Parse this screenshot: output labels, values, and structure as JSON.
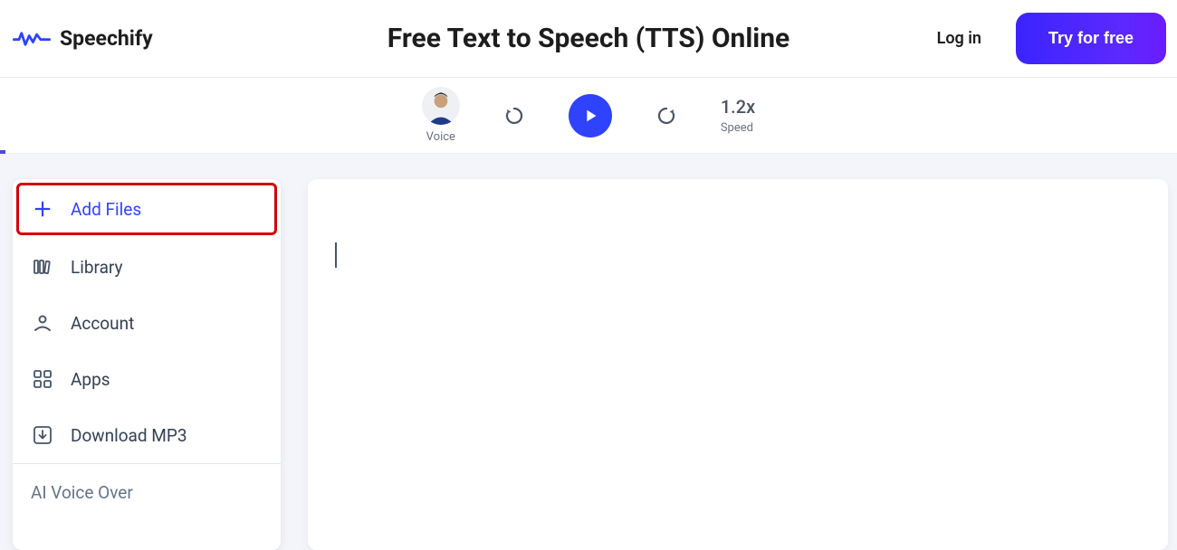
{
  "brand": {
    "name": "Speechify"
  },
  "header": {
    "title": "Free Text to Speech (TTS) Online",
    "login": "Log in",
    "cta": "Try for free"
  },
  "player": {
    "voice_label": "Voice",
    "speed_value": "1.2x",
    "speed_label": "Speed"
  },
  "sidebar": {
    "add_files": "Add Files",
    "library": "Library",
    "account": "Account",
    "apps": "Apps",
    "download": "Download MP3",
    "ai_voice_over": "AI Voice Over"
  },
  "colors": {
    "accent": "#2f43ff",
    "highlight_border": "#d40000"
  }
}
